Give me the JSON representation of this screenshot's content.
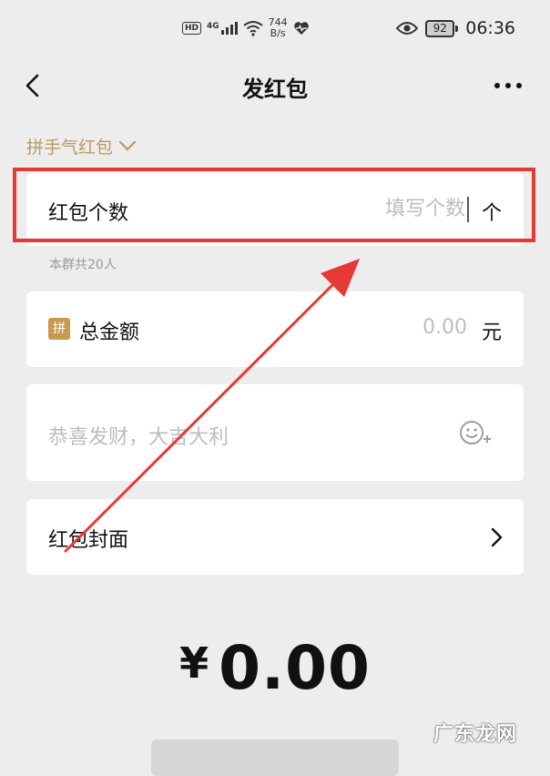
{
  "status_bar": {
    "hd": "HD",
    "signal": "4G",
    "net_speed_value": "744",
    "net_speed_unit": "B/s",
    "battery": "92",
    "time": "06:36"
  },
  "nav": {
    "title": "发红包"
  },
  "packet_type": {
    "label": "拼手气红包"
  },
  "count_row": {
    "label": "红包个数",
    "placeholder": "填写个数",
    "unit": "个"
  },
  "member_note": "本群共20人",
  "amount_row": {
    "badge": "拼",
    "label": "总金额",
    "value": "0.00",
    "unit": "元"
  },
  "greeting": {
    "placeholder": "恭喜发财，大吉大利"
  },
  "cover_row": {
    "label": "红包封面"
  },
  "total": {
    "currency": "¥",
    "value": "0.00"
  },
  "watermark": "广东龙网",
  "colors": {
    "highlight": "#e53935",
    "accent_gold": "#b79a61",
    "badge": "#c79a4e"
  }
}
